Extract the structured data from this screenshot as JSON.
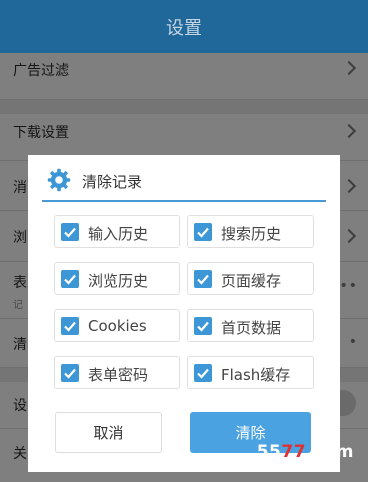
{
  "header": {
    "title": "设置"
  },
  "settings": {
    "rows": [
      {
        "label": "广告过滤"
      },
      {
        "label": "下载设置"
      },
      {
        "label": "消"
      },
      {
        "label": "浏"
      },
      {
        "label": "表",
        "sub": "记"
      },
      {
        "label": "清"
      },
      {
        "label": "设"
      },
      {
        "label": "关"
      }
    ]
  },
  "dialog": {
    "title": "清除记录",
    "icon": "gear-icon",
    "options": [
      {
        "label": "输入历史",
        "checked": true
      },
      {
        "label": "搜索历史",
        "checked": true
      },
      {
        "label": "浏览历史",
        "checked": true
      },
      {
        "label": "页面缓存",
        "checked": true
      },
      {
        "label": "Cookies",
        "checked": true
      },
      {
        "label": "首页数据",
        "checked": true
      },
      {
        "label": "表单密码",
        "checked": true
      },
      {
        "label": "Flash缓存",
        "checked": true
      }
    ],
    "cancel_label": "取消",
    "clear_label": "清除"
  },
  "watermark": {
    "part1": "55",
    "part2": "77",
    "part3": ".com"
  },
  "colors": {
    "header": "#20679a",
    "accent": "#4aa3e0",
    "checkbox": "#3d97d6"
  }
}
